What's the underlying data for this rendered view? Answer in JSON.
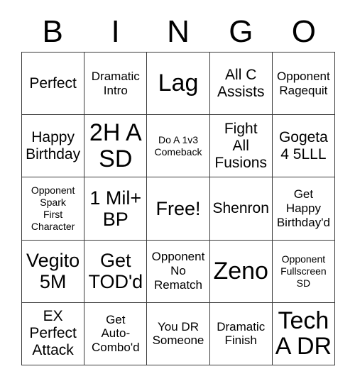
{
  "card": {
    "title_letters": [
      "B",
      "I",
      "N",
      "G",
      "O"
    ],
    "rows": [
      [
        {
          "text": "Perfect",
          "size": "md"
        },
        {
          "text": "Dramatic\nIntro",
          "size": "sm"
        },
        {
          "text": "Lag",
          "size": "xl"
        },
        {
          "text": "All C\nAssists",
          "size": "md"
        },
        {
          "text": "Opponent\nRagequit",
          "size": "sm"
        }
      ],
      [
        {
          "text": "Happy\nBirthday",
          "size": "md"
        },
        {
          "text": "2H A\nSD",
          "size": "xl"
        },
        {
          "text": "Do A 1v3\nComeback",
          "size": "xs"
        },
        {
          "text": "Fight\nAll\nFusions",
          "size": "md"
        },
        {
          "text": "Gogeta\n4 5LLL",
          "size": "md"
        }
      ],
      [
        {
          "text": "Opponent\nSpark\nFirst\nCharacter",
          "size": "xs"
        },
        {
          "text": "1 Mil+\nBP",
          "size": "lg"
        },
        {
          "text": "Free!",
          "size": "lg"
        },
        {
          "text": "Shenron",
          "size": "md"
        },
        {
          "text": "Get\nHappy\nBirthday'd",
          "size": "sm"
        }
      ],
      [
        {
          "text": "Vegito\n5M",
          "size": "lg"
        },
        {
          "text": "Get\nTOD'd",
          "size": "lg"
        },
        {
          "text": "Opponent\nNo\nRematch",
          "size": "sm"
        },
        {
          "text": "Zeno",
          "size": "xl"
        },
        {
          "text": "Opponent\nFullscreen\nSD",
          "size": "xs"
        }
      ],
      [
        {
          "text": "EX\nPerfect\nAttack",
          "size": "md"
        },
        {
          "text": "Get\nAuto-\nCombo'd",
          "size": "sm"
        },
        {
          "text": "You DR\nSomeone",
          "size": "sm"
        },
        {
          "text": "Dramatic\nFinish",
          "size": "sm"
        },
        {
          "text": "Tech\nA DR",
          "size": "xl"
        }
      ]
    ]
  },
  "colors": {
    "background": "#ffffff",
    "text": "#000000",
    "grid_line": "#3a3a3a"
  }
}
